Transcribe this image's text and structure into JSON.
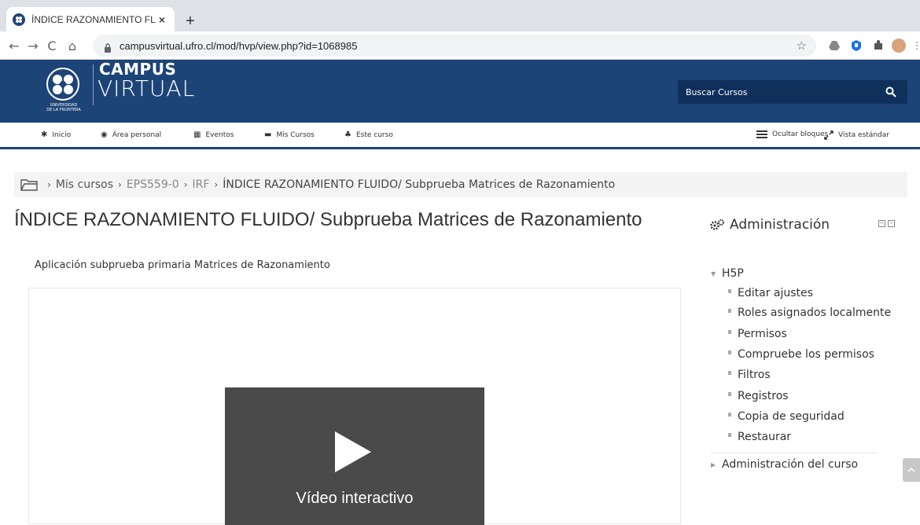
{
  "browser": {
    "tab_title": "ÍNDICE RAZONAMIENTO FLUI",
    "tab_close": "×",
    "new_tab": "+",
    "url": "campusvirtual.ufro.cl/mod/hvp/view.php?id=1068985",
    "back": "←",
    "forward": "→",
    "reload": "C",
    "home": "⌂",
    "bookmark": "☆"
  },
  "header": {
    "logo_top": "CAMPUS",
    "logo_bottom": "VIRTUAL",
    "university_line1": "UNIVERSIDAD",
    "university_line2": "DE LA FRONTERA",
    "search_placeholder": "Buscar Cursos",
    "brand_color": "#1d4477"
  },
  "nav": {
    "items": [
      {
        "icon": "home-icon",
        "glyph": "✱",
        "label": "Inicio"
      },
      {
        "icon": "dashboard-icon",
        "glyph": "◉",
        "label": "Área personal"
      },
      {
        "icon": "calendar-icon",
        "glyph": "▦",
        "label": "Eventos"
      },
      {
        "icon": "courses-icon",
        "glyph": "▬",
        "label": "Mis Cursos"
      },
      {
        "icon": "sitemap-icon",
        "glyph": "♣",
        "label": "Este curso"
      }
    ],
    "hide_blocks": "Ocultar bloques",
    "standard_view": "Vista estándar"
  },
  "breadcrumb": {
    "sep": "›",
    "mis_cursos": "Mis cursos",
    "course": "EPS559-0",
    "section": "IRF",
    "current": "ÍNDICE RAZONAMIENTO FLUIDO/ Subprueba Matrices de Razonamiento"
  },
  "main": {
    "title": "ÍNDICE RAZONAMIENTO FLUIDO/ Subprueba Matrices de Razonamiento",
    "intro": "Aplicación subprueba primaria Matrices de Razonamiento",
    "video_label": "Vídeo interactivo"
  },
  "admin": {
    "title": "Administración",
    "h5p_label": "H5P",
    "items": [
      "Editar ajustes",
      "Roles asignados localmente",
      "Permisos",
      "Compruebe los permisos",
      "Filtros",
      "Registros",
      "Copia de seguridad",
      "Restaurar"
    ],
    "course_admin": "Administración del curso"
  }
}
